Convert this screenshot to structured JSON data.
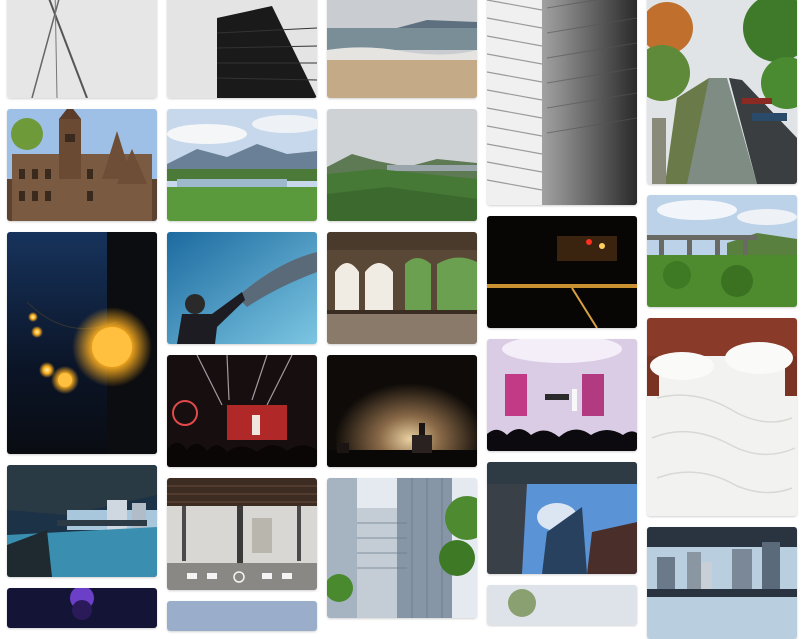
{
  "page": {
    "title": "",
    "background": "#ffffff"
  },
  "gallery": {
    "columns": [
      {
        "tiles": [
          {
            "subject": "antenna-cables",
            "colors": [
              "#e8e8e8",
              "#555555"
            ]
          },
          {
            "subject": "gothic-town-hall",
            "colors": [
              "#8fb3e0",
              "#7a5a40"
            ]
          },
          {
            "subject": "string-lights",
            "colors": [
              "#122544",
              "#ffb020"
            ]
          },
          {
            "subject": "riverwalk-bridge",
            "colors": [
              "#1b3247",
              "#5ea6c6"
            ]
          },
          {
            "subject": "concert-stage",
            "colors": [
              "#151535",
              "#6b3fc8"
            ]
          }
        ]
      },
      {
        "tiles": [
          {
            "subject": "dark-skyscraper",
            "colors": [
              "#e6e6e6",
              "#1a1a1a"
            ]
          },
          {
            "subject": "valley-lake",
            "colors": [
              "#c5d6ea",
              "#4e8a38"
            ]
          },
          {
            "subject": "aquarium-diver",
            "colors": [
              "#1e78a8",
              "#7cc6e2"
            ]
          },
          {
            "subject": "concert-lights",
            "colors": [
              "#1a1012",
              "#d04040"
            ]
          },
          {
            "subject": "elevated-train-street",
            "colors": [
              "#3a2a20",
              "#d8d6d2"
            ]
          },
          {
            "subject": "partial-tile",
            "colors": [
              "#9aaecc",
              "#4a5a70"
            ]
          }
        ]
      },
      {
        "tiles": [
          {
            "subject": "beach-shore",
            "colors": [
              "#c9ccd0",
              "#c8b290"
            ]
          },
          {
            "subject": "green-hills",
            "colors": [
              "#d2d5d8",
              "#4c7a3a"
            ]
          },
          {
            "subject": "arched-colonnade",
            "colors": [
              "#d8d0c0",
              "#4a3a2a"
            ]
          },
          {
            "subject": "smoke-stage",
            "colors": [
              "#0e0b08",
              "#b08a5a"
            ]
          },
          {
            "subject": "glass-towers",
            "colors": [
              "#dfe6ee",
              "#6f8090"
            ]
          }
        ]
      },
      {
        "tiles": [
          {
            "subject": "window-blinds",
            "colors": [
              "#c4c4c4",
              "#2a2a2a"
            ]
          },
          {
            "subject": "night-road",
            "colors": [
              "#0a0806",
              "#d09a30"
            ]
          },
          {
            "subject": "acrobat-concert",
            "colors": [
              "#d8c8e2",
              "#cc3a88"
            ]
          },
          {
            "subject": "towers-from-below",
            "colors": [
              "#5b94d6",
              "#3a3f48"
            ]
          },
          {
            "subject": "partial-tree",
            "colors": [
              "#d8dee4",
              "#8aa070"
            ]
          }
        ]
      },
      {
        "tiles": [
          {
            "subject": "canal-boats",
            "colors": [
              "#dfe3e6",
              "#5a7a40"
            ]
          },
          {
            "subject": "viaduct-valley",
            "colors": [
              "#b9d0e6",
              "#4f8a30"
            ]
          },
          {
            "subject": "unmade-bed",
            "colors": [
              "#8a3a28",
              "#f2f2f0"
            ]
          },
          {
            "subject": "bridge-skyline",
            "colors": [
              "#2a3440",
              "#b9cfe0"
            ]
          }
        ]
      }
    ]
  }
}
